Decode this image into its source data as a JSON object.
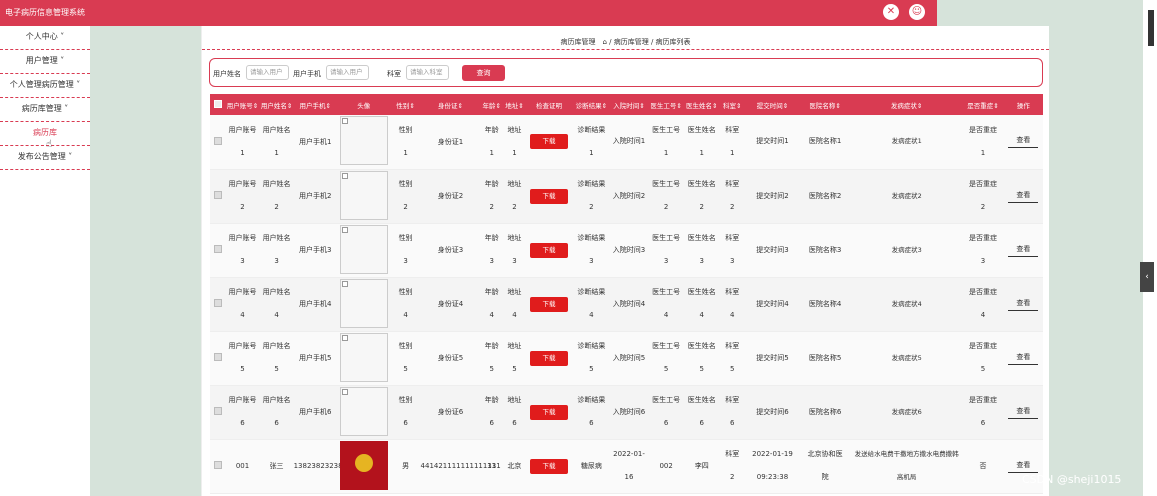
{
  "app": {
    "title": "电子病历信息管理系统"
  },
  "header_icons": [
    "close-circle-icon",
    "user-icon"
  ],
  "sidebar": {
    "items": [
      {
        "label": "个人中心",
        "chevron": "˅"
      },
      {
        "label": "用户管理",
        "chevron": "˅"
      },
      {
        "label": "个人管理病历管理",
        "chevron": "˅"
      },
      {
        "label": "病历库管理",
        "chevron": "˅"
      },
      {
        "label": "病历库",
        "chevron": ""
      },
      {
        "label": "发布公告管理",
        "chevron": "˅"
      }
    ]
  },
  "breadcrumb": {
    "text": "病历库管理　⌂ / 病历库管理 / 病历库列表"
  },
  "search": {
    "name_label": "用户姓名",
    "name_placeholder": "请输入用户",
    "phone_label": "用户手机",
    "phone_placeholder": "请输入用户",
    "dept_label": "科室",
    "dept_placeholder": "请输入科室",
    "button_label": "查询"
  },
  "table": {
    "headers": [
      "用户账号⇕",
      "用户姓名⇕",
      "用户手机⇕",
      "头像",
      "性别⇕",
      "身份证⇕",
      "年龄⇕",
      "地址⇕",
      "检查证明",
      "诊断结果⇕",
      "入院时间⇕",
      "医生工号⇕",
      "医生姓名⇕",
      "科室⇕",
      "提交时间⇕",
      "医院名称⇕",
      "发病症状⇕",
      "是否重症⇕",
      "操作"
    ],
    "download_label": "下载",
    "view_label": "查看",
    "rows": [
      {
        "account": [
          "用户账号",
          "1"
        ],
        "name": [
          "用户姓名",
          "1"
        ],
        "phone": "用户手机1",
        "gender": [
          "性别",
          "1"
        ],
        "idcard": "身份证1",
        "age": [
          "年龄",
          "1"
        ],
        "address": [
          "地址",
          "1"
        ],
        "diagnosis": [
          "诊断结果",
          "1"
        ],
        "admit": "入院时间1",
        "doc_id": [
          "医生工号",
          "1"
        ],
        "doc_name": [
          "医生姓名",
          "1"
        ],
        "dept": [
          "科室",
          "1"
        ],
        "submit": "提交时间1",
        "hospital": "医院名称1",
        "symptom": "发病症状1",
        "severe": [
          "是否重症",
          "1"
        ]
      },
      {
        "account": [
          "用户账号",
          "2"
        ],
        "name": [
          "用户姓名",
          "2"
        ],
        "phone": "用户手机2",
        "gender": [
          "性别",
          "2"
        ],
        "idcard": "身份证2",
        "age": [
          "年龄",
          "2"
        ],
        "address": [
          "地址",
          "2"
        ],
        "diagnosis": [
          "诊断结果",
          "2"
        ],
        "admit": "入院时间2",
        "doc_id": [
          "医生工号",
          "2"
        ],
        "doc_name": [
          "医生姓名",
          "2"
        ],
        "dept": [
          "科室",
          "2"
        ],
        "submit": "提交时间2",
        "hospital": "医院名称2",
        "symptom": "发病症状2",
        "severe": [
          "是否重症",
          "2"
        ]
      },
      {
        "account": [
          "用户账号",
          "3"
        ],
        "name": [
          "用户姓名",
          "3"
        ],
        "phone": "用户手机3",
        "gender": [
          "性别",
          "3"
        ],
        "idcard": "身份证3",
        "age": [
          "年龄",
          "3"
        ],
        "address": [
          "地址",
          "3"
        ],
        "diagnosis": [
          "诊断结果",
          "3"
        ],
        "admit": "入院时间3",
        "doc_id": [
          "医生工号",
          "3"
        ],
        "doc_name": [
          "医生姓名",
          "3"
        ],
        "dept": [
          "科室",
          "3"
        ],
        "submit": "提交时间3",
        "hospital": "医院名称3",
        "symptom": "发病症状3",
        "severe": [
          "是否重症",
          "3"
        ]
      },
      {
        "account": [
          "用户账号",
          "4"
        ],
        "name": [
          "用户姓名",
          "4"
        ],
        "phone": "用户手机4",
        "gender": [
          "性别",
          "4"
        ],
        "idcard": "身份证4",
        "age": [
          "年龄",
          "4"
        ],
        "address": [
          "地址",
          "4"
        ],
        "diagnosis": [
          "诊断结果",
          "4"
        ],
        "admit": "入院时间4",
        "doc_id": [
          "医生工号",
          "4"
        ],
        "doc_name": [
          "医生姓名",
          "4"
        ],
        "dept": [
          "科室",
          "4"
        ],
        "submit": "提交时间4",
        "hospital": "医院名称4",
        "symptom": "发病症状4",
        "severe": [
          "是否重症",
          "4"
        ]
      },
      {
        "account": [
          "用户账号",
          "5"
        ],
        "name": [
          "用户姓名",
          "5"
        ],
        "phone": "用户手机5",
        "gender": [
          "性别",
          "5"
        ],
        "idcard": "身份证5",
        "age": [
          "年龄",
          "5"
        ],
        "address": [
          "地址",
          "5"
        ],
        "diagnosis": [
          "诊断结果",
          "5"
        ],
        "admit": "入院时间5",
        "doc_id": [
          "医生工号",
          "5"
        ],
        "doc_name": [
          "医生姓名",
          "5"
        ],
        "dept": [
          "科室",
          "5"
        ],
        "submit": "提交时间5",
        "hospital": "医院名称5",
        "symptom": "发病症状5",
        "severe": [
          "是否重症",
          "5"
        ]
      },
      {
        "account": [
          "用户账号",
          "6"
        ],
        "name": [
          "用户姓名",
          "6"
        ],
        "phone": "用户手机6",
        "gender": [
          "性别",
          "6"
        ],
        "idcard": "身份证6",
        "age": [
          "年龄",
          "6"
        ],
        "address": [
          "地址",
          "6"
        ],
        "diagnosis": [
          "诊断结果",
          "6"
        ],
        "admit": "入院时间6",
        "doc_id": [
          "医生工号",
          "6"
        ],
        "doc_name": [
          "医生姓名",
          "6"
        ],
        "dept": [
          "科室",
          "6"
        ],
        "submit": "提交时间6",
        "hospital": "医院名称6",
        "symptom": "发病症状6",
        "severe": [
          "是否重症",
          "6"
        ]
      },
      {
        "account": [
          "001",
          ""
        ],
        "name": [
          "张三",
          ""
        ],
        "phone": "13823823238",
        "gender": [
          "男",
          ""
        ],
        "idcard": "441421111111111111",
        "age": [
          "33",
          ""
        ],
        "address": [
          "北京",
          ""
        ],
        "diagnosis": [
          "糖尿病",
          ""
        ],
        "admit": "2022-01-\n16",
        "doc_id": [
          "002",
          ""
        ],
        "doc_name": [
          "李四",
          ""
        ],
        "dept": [
          "科室",
          "2"
        ],
        "submit": "2022-01-19\n09:23:38",
        "hospital": "北京协和医\n院",
        "symptom": "发送给水电费干撒地方撒水电费撒韩\n高机局",
        "severe": [
          "否",
          ""
        ],
        "photo": true
      }
    ]
  },
  "watermark": "CSDN @sheji1015",
  "edge_handle": "‹"
}
